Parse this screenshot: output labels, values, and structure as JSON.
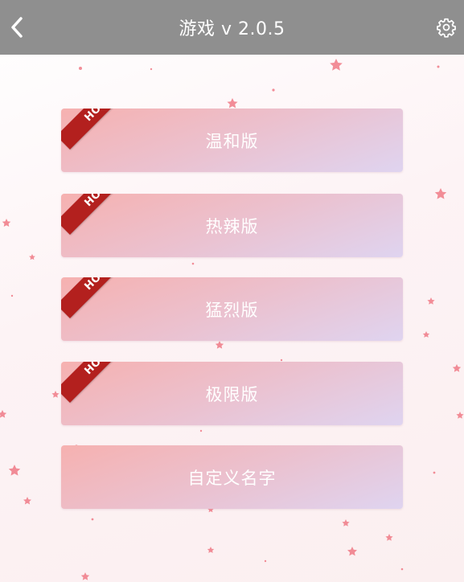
{
  "header": {
    "title": "游戏 v 2.0.5",
    "back_icon": "chevron-left-icon",
    "settings_icon": "gear-icon"
  },
  "menu": {
    "items": [
      {
        "label": "温和版",
        "badge": "HOT"
      },
      {
        "label": "热辣版",
        "badge": "HOT"
      },
      {
        "label": "猛烈版",
        "badge": "HOT"
      },
      {
        "label": "极限版",
        "badge": "HOT"
      },
      {
        "label": "自定义名字"
      }
    ]
  },
  "colors": {
    "header_bg": "#8f8f8f",
    "button_gradient_start": "#f6b1b0",
    "button_gradient_end": "#dfd4f0",
    "ribbon": "#b3201e",
    "star": "#f07a86"
  }
}
